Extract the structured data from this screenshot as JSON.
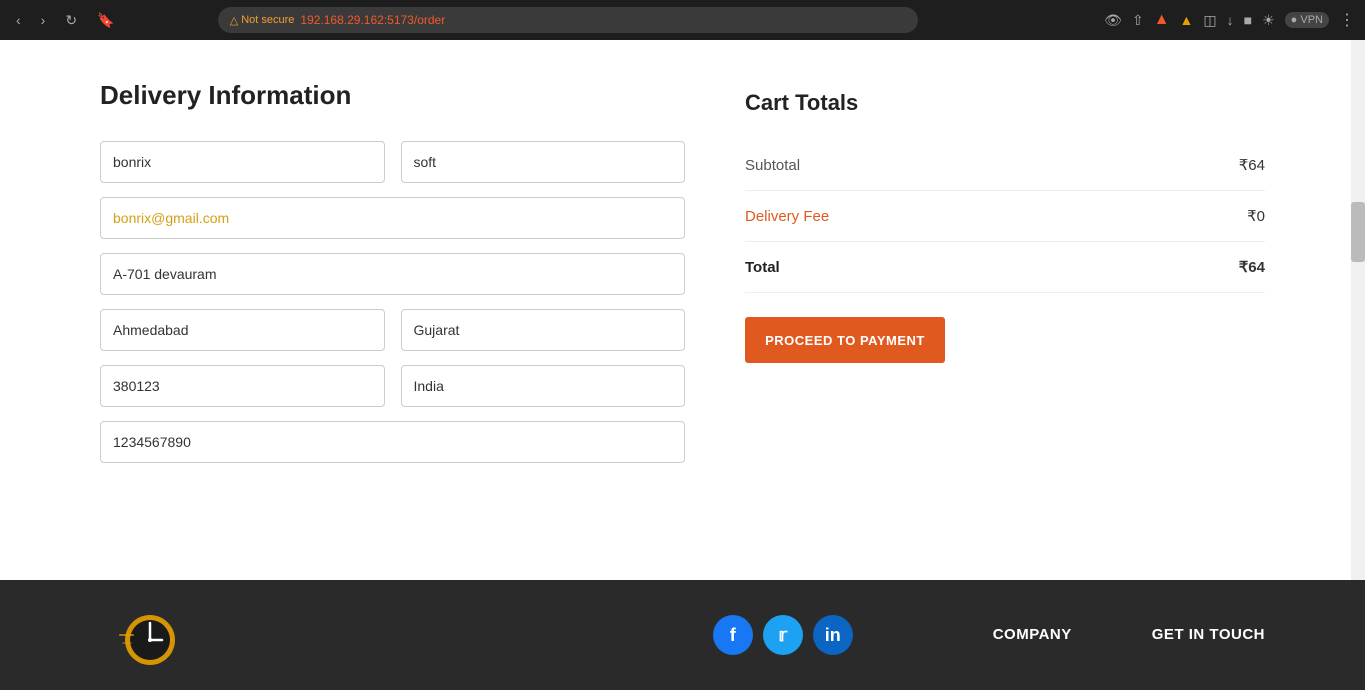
{
  "browser": {
    "url_prefix": "192.168.29.162:",
    "url_port": "5173",
    "url_path": "/order",
    "not_secure_label": "Not secure",
    "nav": {
      "back": "‹",
      "forward": "›",
      "refresh": "↻",
      "bookmark": "🔖"
    }
  },
  "delivery": {
    "title": "Delivery Information",
    "fields": {
      "first_name": "bonrix",
      "last_name": "soft",
      "email": "bonrix@gmail.com",
      "address": "A-701 devauram",
      "city": "Ahmedabad",
      "state": "Gujarat",
      "zip": "380123",
      "country": "India",
      "phone": "1234567890"
    }
  },
  "cart": {
    "title": "Cart Totals",
    "subtotal_label": "Subtotal",
    "subtotal_value": "₹64",
    "delivery_label": "Delivery Fee",
    "delivery_value": "₹0",
    "total_label": "Total",
    "total_value": "₹64",
    "proceed_button": "PROCEED TO PAYMENT"
  },
  "footer": {
    "company_label": "COMPANY",
    "get_in_touch_label": "GET IN TOUCH",
    "social": {
      "facebook": "f",
      "twitter": "t",
      "linkedin": "in"
    }
  }
}
